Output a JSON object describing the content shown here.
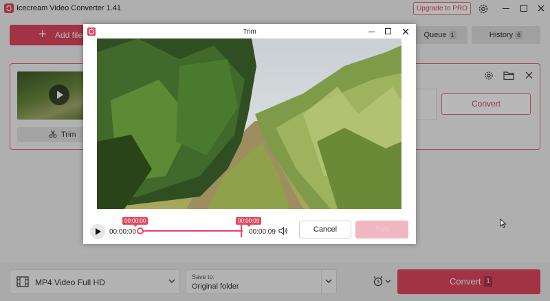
{
  "app": {
    "title": "Icecream Video Converter 1.41",
    "upgrade_label": "Upgrade to PRO",
    "accent_color": "#e0475f"
  },
  "toolbar": {
    "add_file_label": "Add file",
    "tabs": [
      {
        "label": "Queue",
        "count": "1"
      },
      {
        "label": "History",
        "count": "6"
      }
    ]
  },
  "file_card": {
    "trim_label": "Trim",
    "convert_label": "Convert"
  },
  "bottom_bar": {
    "format": "MP4 Video Full HD",
    "save_to_caption": "Save to:",
    "save_to_value": "Original folder",
    "convert_label": "Convert",
    "convert_count": "1"
  },
  "trim_dialog": {
    "title": "Trim",
    "time_start": "00:00:00",
    "time_end": "00:00:09",
    "tooltip_start": "00:00:00",
    "tooltip_end": "00:00:09",
    "selection_start_fraction": 0,
    "selection_end_fraction": 1,
    "cancel_label": "Cancel",
    "trim_label": "Trim"
  },
  "icons": {
    "app_logo": "refresh-logo-icon",
    "settings": "gear-icon",
    "folder": "folder-icon",
    "close": "close-icon",
    "scissors": "scissors-icon",
    "film": "film-icon",
    "schedule": "alarm-clock-icon",
    "volume": "speaker-icon"
  }
}
